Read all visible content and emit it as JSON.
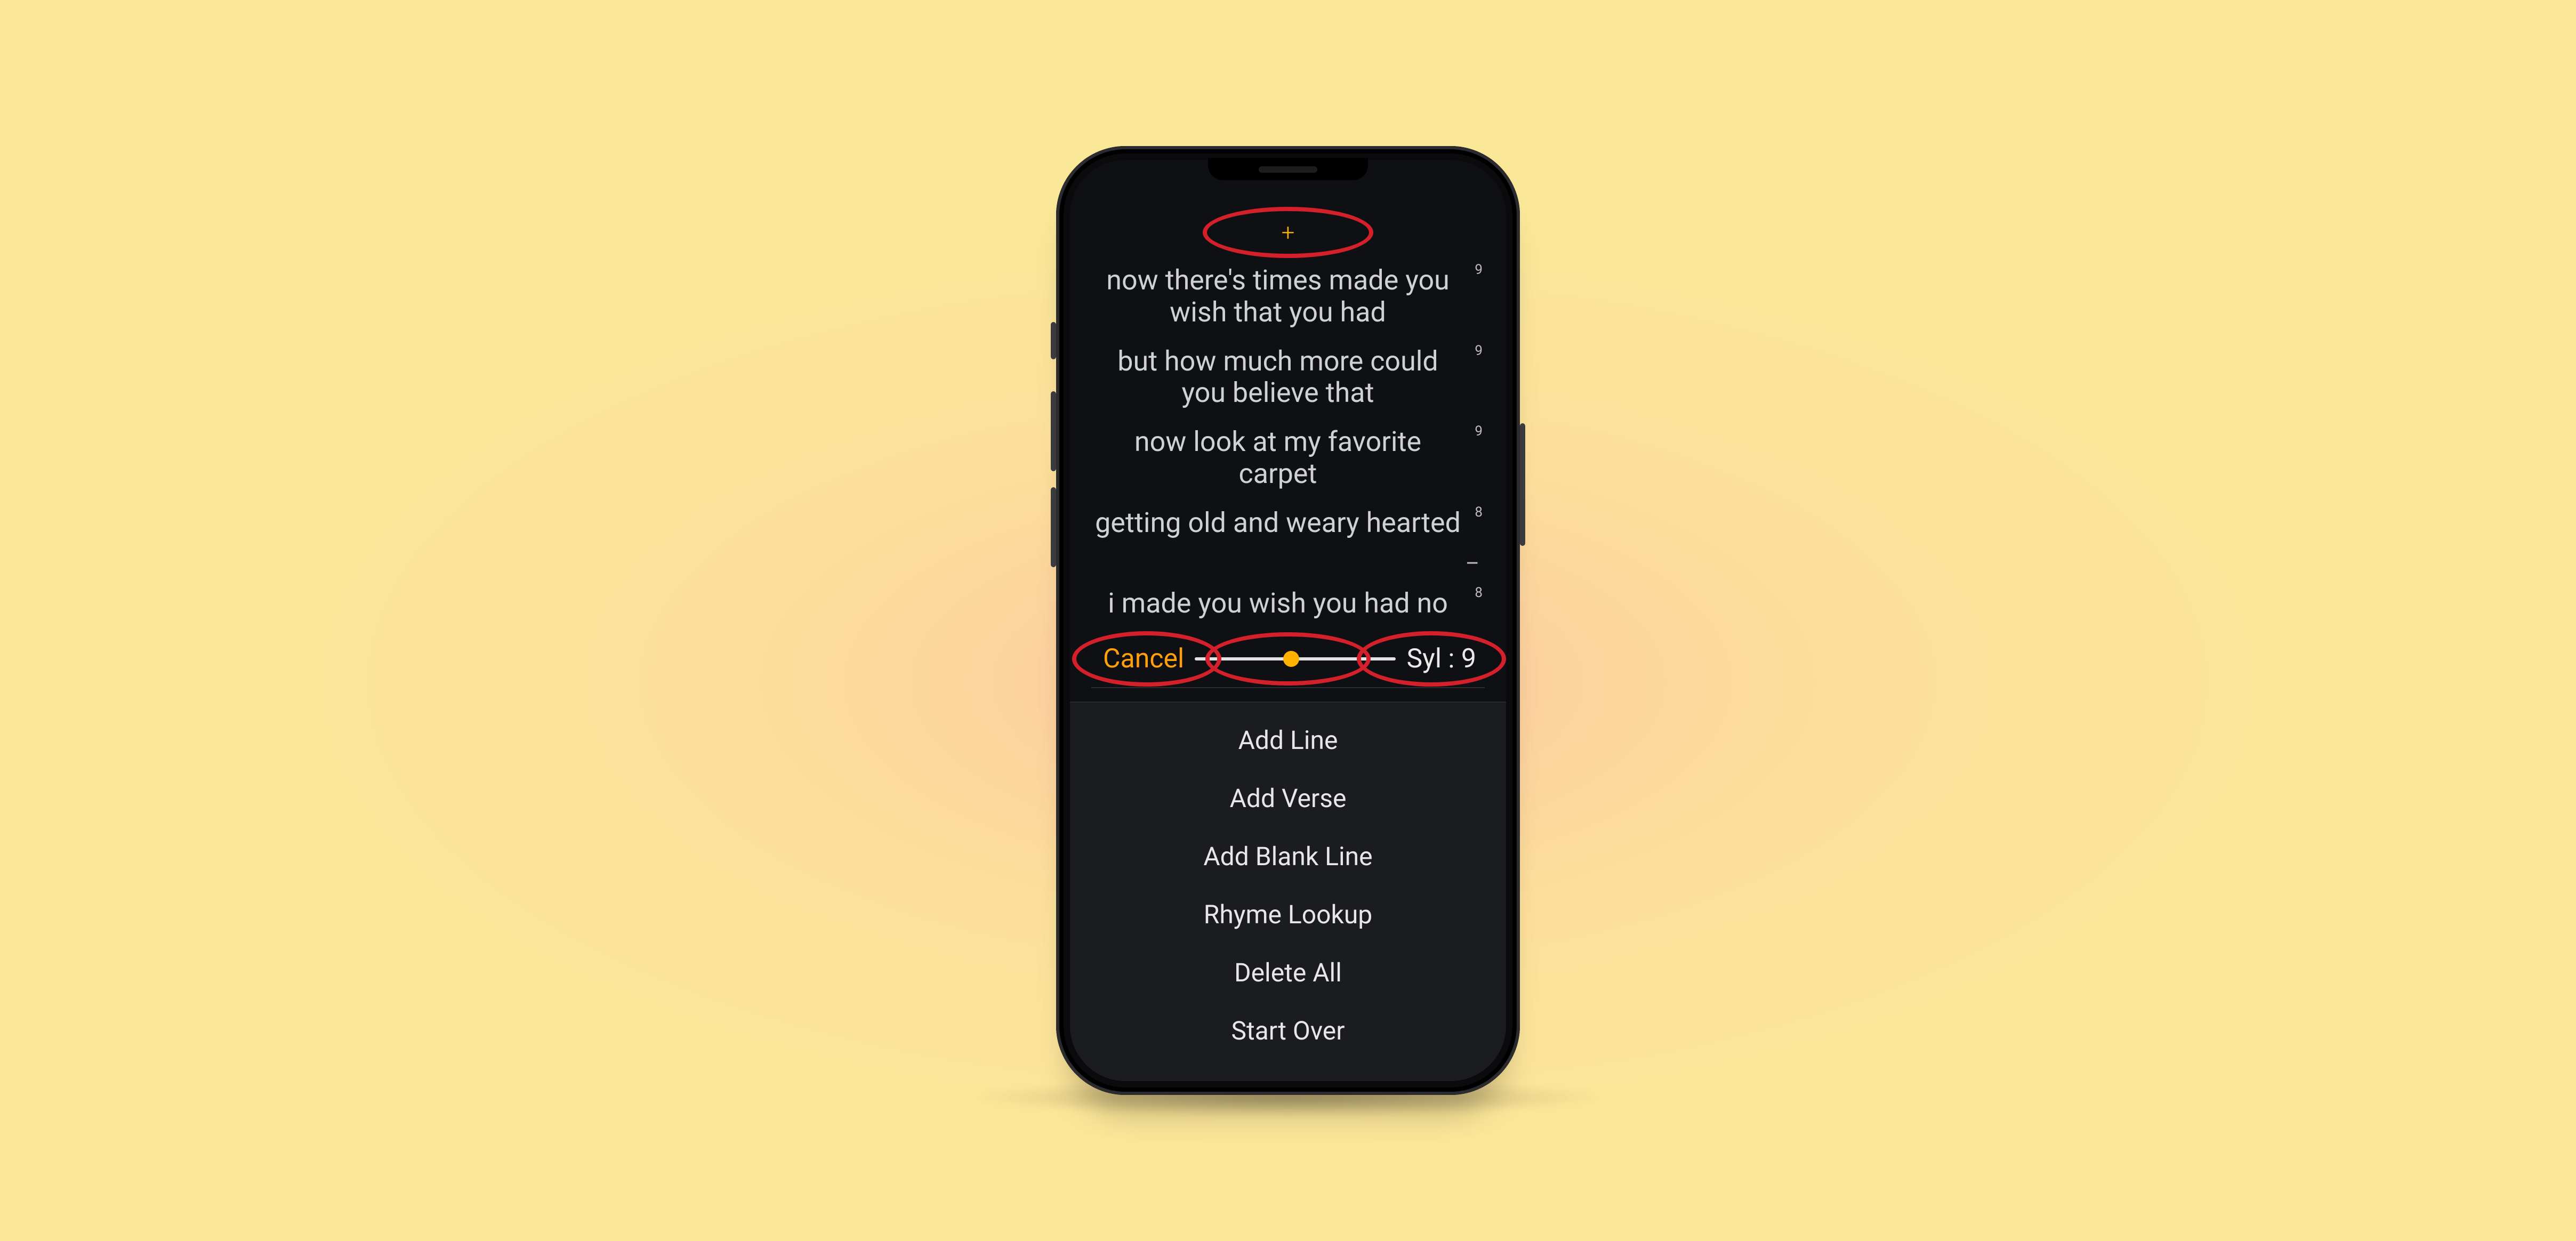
{
  "accent": "#ff9f0a",
  "plus_icon_label": "+",
  "lyrics": [
    {
      "text": "now there's times made you wish that you had",
      "syl": "9"
    },
    {
      "text": "but how much more could you believe that",
      "syl": "9"
    },
    {
      "text": "now look at my favorite carpet",
      "syl": "9"
    },
    {
      "text": "getting old and weary hearted",
      "syl": "8"
    },
    {
      "dash": "–"
    },
    {
      "text": "i made you wish you had no",
      "syl": "8"
    }
  ],
  "controls": {
    "cancel_label": "Cancel",
    "syl_label": "Syl : 9",
    "syl_value": 9
  },
  "menu": {
    "items": [
      "Add Line",
      "Add Verse",
      "Add Blank Line",
      "Rhyme Lookup",
      "Delete All",
      "Start Over"
    ]
  }
}
